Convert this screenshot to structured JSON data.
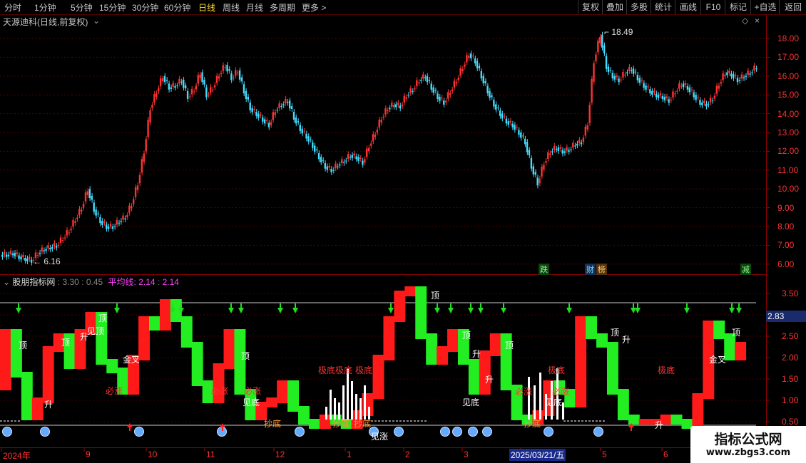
{
  "toolbar": {
    "periods": [
      "分时",
      "1分钟",
      "5分钟",
      "15分钟",
      "30分钟",
      "60分钟",
      "日线",
      "周线",
      "月线",
      "多周期",
      "更多 >"
    ],
    "active_period": "日线",
    "right_buttons": [
      "复权",
      "叠加",
      "多股",
      "统计",
      "画线",
      "F10",
      "标记",
      "+自选",
      "返回"
    ]
  },
  "stock": {
    "title": "天源迪科(日线,前复权)",
    "high_label": "18.49",
    "low_label": "6.16"
  },
  "price_axis": [
    "18.00",
    "17.00",
    "16.00",
    "15.00",
    "14.00",
    "13.00",
    "12.00",
    "11.00",
    "10.00",
    "9.00",
    "8.00",
    "7.00",
    "6.00"
  ],
  "events": [
    "跌",
    "财",
    "榜",
    "减"
  ],
  "indicator": {
    "name": "股朋指标网",
    "v1": "3.30",
    "v2": "0.45",
    "avg_label": "平均线:",
    "avg1": "2.14",
    "avg2": "2.14",
    "axis": [
      "3.50",
      "3.00",
      "2.50",
      "2.00",
      "1.50",
      "1.00",
      "0.50"
    ],
    "current_value": "2.83"
  },
  "annotations": [
    {
      "text": "顶",
      "color": "#ffffff"
    },
    {
      "text": "顶",
      "color": "#ffffff"
    },
    {
      "text": "见顶",
      "color": "#ffffff"
    },
    {
      "text": "升",
      "color": "#ffffff"
    },
    {
      "text": "顶",
      "color": "#ffffff"
    },
    {
      "text": "金叉",
      "color": "#ffffff"
    },
    {
      "text": "必涨",
      "color": "#ff3333"
    },
    {
      "text": "升",
      "color": "#ffffff"
    },
    {
      "text": "顶",
      "color": "#ffffff"
    },
    {
      "text": "必涨",
      "color": "#ff3333"
    },
    {
      "text": "必涨",
      "color": "#ff3333"
    },
    {
      "text": "见底",
      "color": "#ffffff"
    },
    {
      "text": "抄底",
      "color": "#ff9933"
    },
    {
      "text": "极底",
      "color": "#ff3333"
    },
    {
      "text": "极底",
      "color": "#ff3333"
    },
    {
      "text": "极底",
      "color": "#ff3333"
    },
    {
      "text": "抄底",
      "color": "#ff9933"
    },
    {
      "text": "抄底",
      "color": "#ff9933"
    },
    {
      "text": "见涨",
      "color": "#ffffff"
    },
    {
      "text": "顶",
      "color": "#ffffff"
    },
    {
      "text": "顶",
      "color": "#ffffff"
    },
    {
      "text": "升",
      "color": "#ffffff"
    },
    {
      "text": "顶",
      "color": "#ffffff"
    },
    {
      "text": "升",
      "color": "#ffffff"
    },
    {
      "text": "见底",
      "color": "#ffffff"
    },
    {
      "text": "必涨",
      "color": "#ff3333"
    },
    {
      "text": "极底",
      "color": "#ff3333"
    },
    {
      "text": "必涨",
      "color": "#ff3333"
    },
    {
      "text": "见底",
      "color": "#ffffff"
    },
    {
      "text": "抄底",
      "color": "#ff9933"
    },
    {
      "text": "顶",
      "color": "#ffffff"
    },
    {
      "text": "升",
      "color": "#ffffff"
    },
    {
      "text": "极底",
      "color": "#ff3333"
    },
    {
      "text": "金叉",
      "color": "#ffffff"
    },
    {
      "text": "顶",
      "color": "#ffffff"
    },
    {
      "text": "升",
      "color": "#ffffff"
    }
  ],
  "time_axis": [
    "2024年",
    "9",
    "10",
    "11",
    "12",
    "1",
    "2",
    "3",
    "4",
    "5",
    "6"
  ],
  "time_cursor": "2025/03/21/五",
  "watermark": {
    "title": "指标公式网",
    "url": "www.zbgs3.com"
  }
}
